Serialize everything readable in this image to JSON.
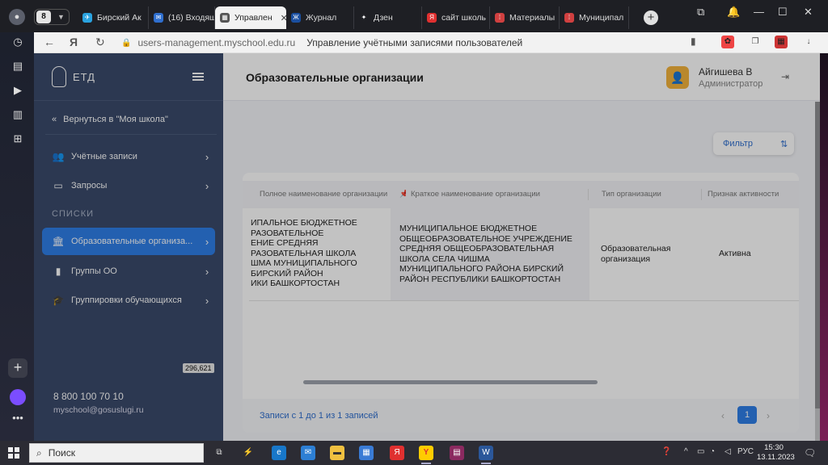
{
  "browser": {
    "tab_counter": "8",
    "tabs": [
      {
        "label": "Бирский Ак",
        "color": "#2aa3e0",
        "glyph": "✈"
      },
      {
        "label": "(16) Входящ",
        "color": "#2f6fcf",
        "glyph": "✉"
      },
      {
        "label": "Управлен",
        "color": "#555555",
        "glyph": "▦",
        "active": true
      },
      {
        "label": "Журнал",
        "color": "#1a4fa0",
        "glyph": "Ж"
      },
      {
        "label": "Дзен",
        "color": "#222222",
        "glyph": "✦"
      },
      {
        "label": "сайт школь",
        "color": "#e03030",
        "glyph": "Я"
      },
      {
        "label": "Материалы",
        "color": "#d04040",
        "glyph": "⁞"
      },
      {
        "label": "Муниципал",
        "color": "#d04040",
        "glyph": "⁞"
      }
    ],
    "url_domain": "users-management.myschool.edu.ru",
    "page_title": "Управление учётными записями пользователей"
  },
  "sidebar": {
    "logo": "ЕТД",
    "back_label": "Вернуться в \"Моя школа\"",
    "items_top": [
      {
        "label": "Учётные записи"
      },
      {
        "label": "Запросы"
      }
    ],
    "section_label": "СПИСКИ",
    "items_lists": [
      {
        "label": "Образовательные организа...",
        "active": true
      },
      {
        "label": "Группы ОО"
      },
      {
        "label": "Группировки обучающихся"
      }
    ],
    "counter": "296,621",
    "phone": "8 800 100 70 10",
    "email": "myschool@gosuslugi.ru"
  },
  "header": {
    "title": "Образовательные организации",
    "user_name": "Айгишева В",
    "user_role": "Администратор"
  },
  "filter": {
    "label": "Фильтр"
  },
  "table": {
    "columns": [
      "Полное наименование организации",
      "Краткое наименование организации",
      "Тип организации",
      "Признак активности"
    ],
    "row": {
      "full_name": "ИПАЛЬНОЕ БЮДЖЕТНОЕ\nРАЗОВАТЕЛЬНОЕ\nЕНИЕ СРЕДНЯЯ\nРАЗОВАТЕЛЬНАЯ ШКОЛА\nШМА МУНИЦИПАЛЬНОГО\nБИРСКИЙ РАЙОН\nИКИ БАШКОРТОСТАН",
      "short_name": "МУНИЦИПАЛЬНОЕ БЮДЖЕТНОЕ\nОБЩЕОБРАЗОВАТЕЛЬНОЕ УЧРЕЖДЕНИЕ\nСРЕДНЯЯ ОБЩЕОБРАЗОВАТЕЛЬНАЯ\nШКОЛА СЕЛА ЧИШМА\nМУНИЦИПАЛЬНОГО РАЙОНА БИРСКИЙ\nРАЙОН РЕСПУБЛИКИ БАШКОРТОСТАН",
      "type": "Образовательная\nорганизация",
      "active": "Активна"
    },
    "records_label": "Записи с 1 до 1 из 1 записей",
    "current_page": "1"
  },
  "taskbar": {
    "search_placeholder": "Поиск",
    "lang": "РУС",
    "time": "15:30",
    "date": "13.11.2023"
  },
  "colors": {
    "accent": "#2f7fe8",
    "sidebar": "#3a4a6b",
    "avatar": "#f4b33c"
  }
}
